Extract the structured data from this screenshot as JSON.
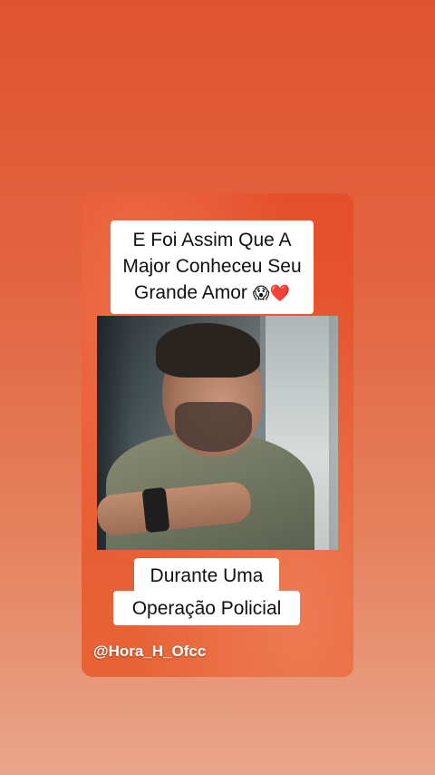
{
  "caption_top": {
    "line1": "E Foi Assim Que A",
    "line2": "Major Conheceu Seu",
    "line3_text": "Grande Amor ",
    "line3_emoji1": "😱",
    "line3_emoji2": "❤️"
  },
  "caption_bottom": {
    "line1": "Durante Uma",
    "line2": "Operação Policial"
  },
  "watermark": "@Hora_H_Ofcc",
  "colors": {
    "background_top": "#e0532f",
    "background_bottom": "#e9a68a",
    "card": "#e4502c",
    "caption_bg": "#ffffff",
    "caption_text": "#111111"
  }
}
